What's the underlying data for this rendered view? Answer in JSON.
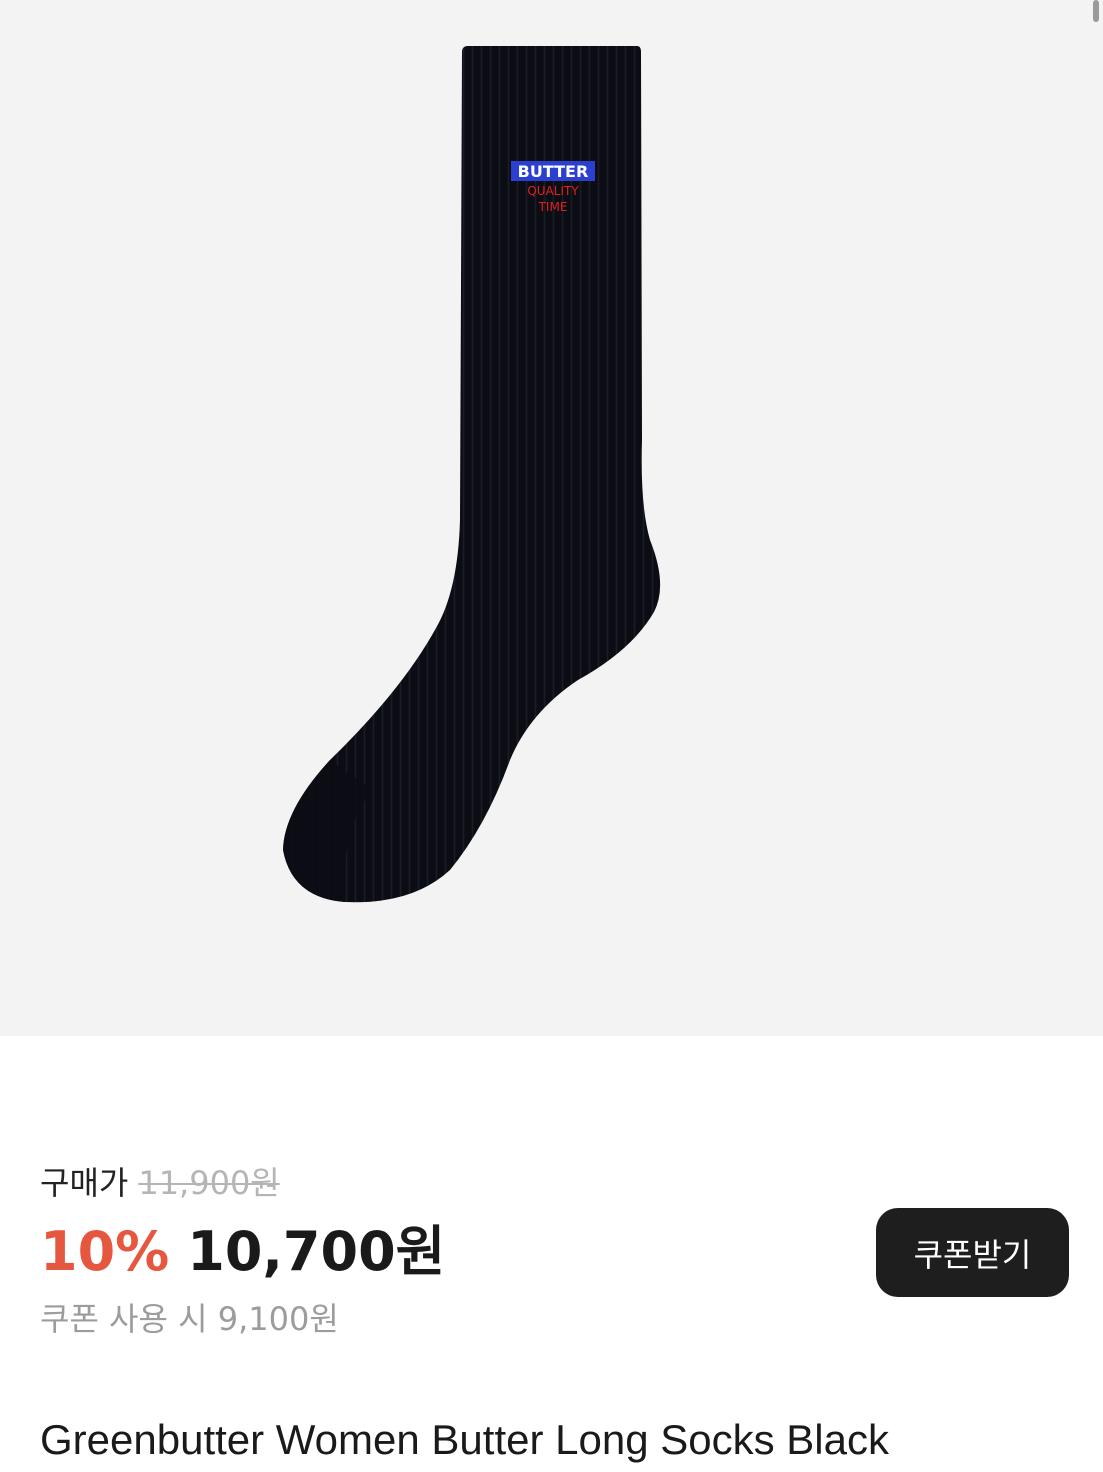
{
  "product_image": {
    "alt": "Black ribbed long sock with BUTTER QUALITY TIME embroidered logo",
    "logo": {
      "line1": "BUTTER",
      "line2": "QUALITY",
      "line3": "TIME"
    },
    "colors": {
      "background": "#f3f3f3",
      "sock": "#0c0d14",
      "logo_blue": "#2b3fd0",
      "logo_red": "#e02020"
    }
  },
  "price": {
    "label": "구매가",
    "original": "11,900원",
    "discount": "10%",
    "sale": "10,700원",
    "coupon_note": "쿠폰 사용 시 9,100원"
  },
  "coupon_button": {
    "label": "쿠폰받기"
  },
  "product": {
    "title": "Greenbutter Women Butter Long Socks Black"
  },
  "colors": {
    "discount": "#e5573f",
    "button_bg": "#1e1e1e",
    "muted": "#9c9c9c"
  }
}
